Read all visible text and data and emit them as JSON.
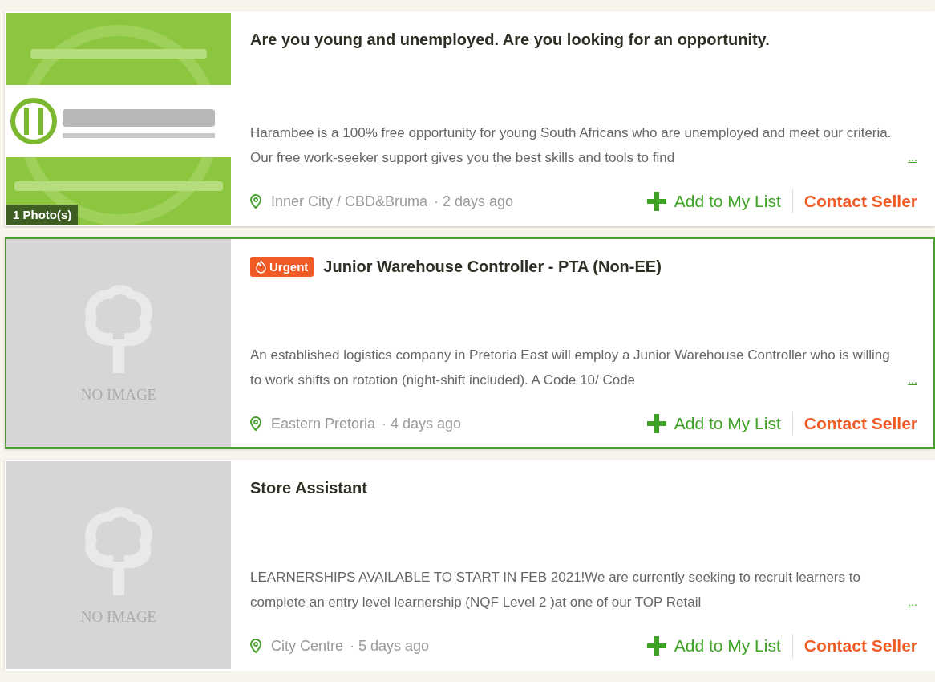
{
  "listings": [
    {
      "image": {
        "kind": "picture",
        "photo_count": "1 Photo(s)"
      },
      "highlighted": false,
      "title": "Are you young and unemployed. Are you looking for an opportunity.",
      "description": "Harambee is a 100% free opportunity for young South Africans who are unemployed and meet our criteria. Our free work-seeker support gives you the best skills and tools to find",
      "more": "...",
      "location": "Inner City / CBD&Bruma",
      "age": "· 2 days ago",
      "add_label": "Add to My List",
      "contact_label": "Contact Seller"
    },
    {
      "image": {
        "kind": "none",
        "label": "NO IMAGE"
      },
      "highlighted": true,
      "badge": "Urgent",
      "title": "Junior Warehouse Controller - PTA (Non-EE)",
      "description": "An established logistics company in Pretoria East will employ a Junior Warehouse Controller who is willing to work shifts on rotation (night-shift included). A Code 10/ Code",
      "more": "...",
      "location": "Eastern Pretoria",
      "age": "· 4 days ago",
      "add_label": "Add to My List",
      "contact_label": "Contact Seller"
    },
    {
      "image": {
        "kind": "none",
        "label": "NO IMAGE"
      },
      "highlighted": false,
      "title": "Store Assistant",
      "description": "LEARNERSHIPS AVAILABLE TO START IN FEB 2021!We are currently seeking to recruit learners to complete an entry level learnership (NQF Level 2 )at one of our TOP Retail",
      "more": "...",
      "location": "City Centre",
      "age": "· 5 days ago",
      "add_label": "Add to My List",
      "contact_label": "Contact Seller"
    }
  ]
}
